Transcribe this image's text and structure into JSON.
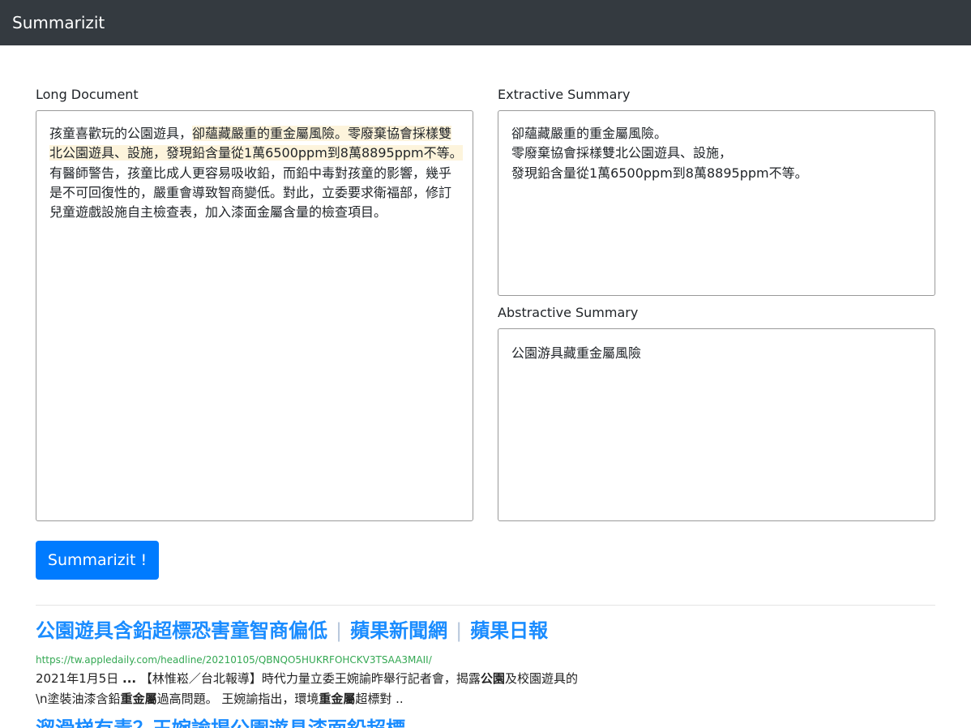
{
  "app": {
    "brand": "Summarizit"
  },
  "long_document": {
    "label": "Long Document",
    "lines": [
      {
        "plain": "孩童喜歡玩的公園遊具，",
        "highlight": "卻蘊藏嚴重的重金屬風險。零廢棄協會採樣雙"
      },
      {
        "plain": "",
        "highlight": "北公園遊具、設施，發現鉛含量從1萬6500ppm到8萬8895ppm不等。"
      },
      {
        "plain": "有醫師警告，孩童比成人更容易吸收鉛，而鉛中毒對孩童的影響，幾乎",
        "highlight": ""
      },
      {
        "plain": "是不可回復性的，嚴重會導致智商變低。對此，立委要求衛福部，修訂",
        "highlight": ""
      },
      {
        "plain": "兒童遊戲設施自主檢查表，加入漆面金屬含量的檢查項目。",
        "highlight": ""
      }
    ]
  },
  "extractive_summary": {
    "label": "Extractive Summary",
    "lines": [
      "卻蘊藏嚴重的重金屬風險。",
      "零廢棄協會採樣雙北公園遊具、設施，",
      "發現鉛含量從1萬6500ppm到8萬8895ppm不等。"
    ]
  },
  "abstractive_summary": {
    "label": "Abstractive Summary",
    "text": "公園游具藏重金屬風險"
  },
  "actions": {
    "summarize_label": "Summarizit !"
  },
  "results": [
    {
      "title": "公園遊具含鉛超標恐害童智商偏低",
      "title_parts": [
        "蘋果新聞網",
        "蘋果日報"
      ],
      "separator": "|",
      "url": "https://tw.appledaily.com/headline/20210105/QBNQO5HUKRFOHCKV3TSAA3MAII/",
      "snippet_line1": "2021年1月5日 ... 【林惟崧／台北報導】時代力量立委王婉諭昨舉行記者會，揭露公園及校園遊具的",
      "snippet_line2": "\\n塗裝油漆含鉛重金屬過高問題。 王婉諭指出，環境重金屬超標對 .."
    },
    {
      "title": "溜滑梯有毒？王婉諭揭公園遊具漆面鉛超標"
    }
  ]
}
